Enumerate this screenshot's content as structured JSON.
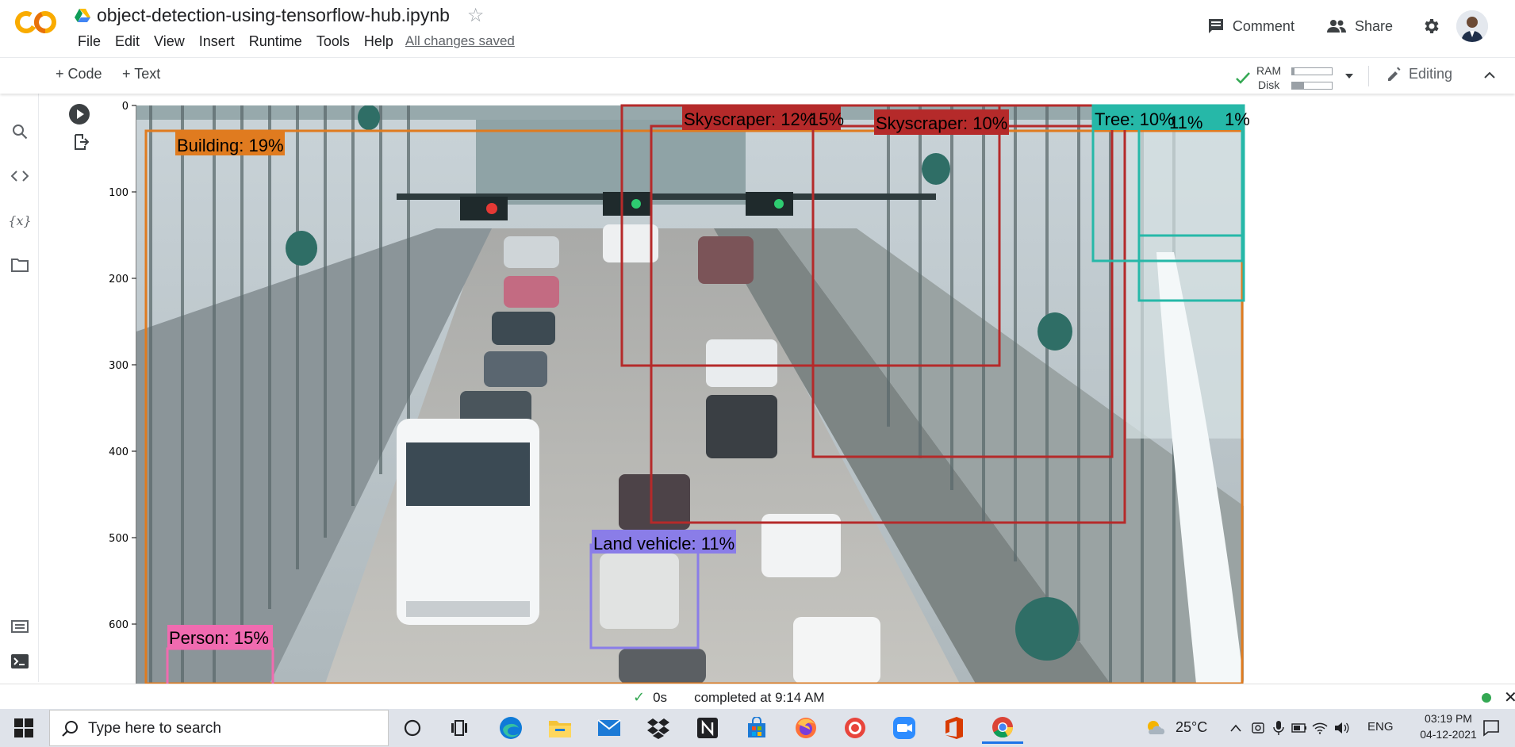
{
  "header": {
    "notebook_title": "object-detection-using-tensorflow-hub.ipynb",
    "logo_text": "CO",
    "menu": [
      "File",
      "Edit",
      "View",
      "Insert",
      "Runtime",
      "Tools",
      "Help"
    ],
    "save_status": "All changes saved",
    "comment_label": "Comment",
    "share_label": "Share",
    "star_glyph": "☆"
  },
  "toolbar": {
    "add_code_label": "+ Code",
    "add_text_label": "+ Text",
    "ram_label": "RAM",
    "disk_label": "Disk",
    "ram_usage": 0.05,
    "disk_usage": 0.3,
    "editing_label": "Editing"
  },
  "left_rail": {
    "icons": [
      "table-of-contents-icon",
      "search-icon",
      "code-snippets-icon",
      "variables-icon",
      "files-icon",
      "command-palette-icon",
      "terminal-icon"
    ],
    "variables_glyph": "{x}"
  },
  "output": {
    "y_ticks": [
      "0",
      "100",
      "200",
      "300",
      "400",
      "500",
      "600"
    ],
    "detections": [
      {
        "label": "Building: 19%",
        "color": "#e07b1f"
      },
      {
        "label": "Skyscraper: 12%",
        "color": "#b52a2a"
      },
      {
        "label": "15%",
        "color": "#b52a2a"
      },
      {
        "label": "Skyscraper: 10%",
        "color": "#b52a2a"
      },
      {
        "label": "Tree: 10%",
        "color": "#26b8a8"
      },
      {
        "label": "11%",
        "color": "#26b8a8"
      },
      {
        "label": "1%",
        "color": "#26b8a8"
      },
      {
        "label": "Land vehicle: 11%",
        "color": "#8a7de8"
      },
      {
        "label": "Person: 15%",
        "color": "#f06bb0"
      }
    ]
  },
  "status_bar": {
    "check_glyph": "✓",
    "elapsed": "0s",
    "completed": "completed at 9:14 AM",
    "close_glyph": "✕"
  },
  "taskbar": {
    "search_placeholder": "Type here to search",
    "apps": [
      "cortana-icon",
      "task-view-icon",
      "edge-icon",
      "file-explorer-icon",
      "mail-icon",
      "dropbox-icon",
      "notion-icon",
      "store-icon",
      "firefox-icon",
      "screen-recorder-icon",
      "zoom-icon",
      "office-icon",
      "chrome-icon"
    ],
    "active_app": "chrome-icon",
    "temperature": "25°C",
    "language": "ENG",
    "time": "03:19 PM",
    "date": "04-12-2021"
  }
}
